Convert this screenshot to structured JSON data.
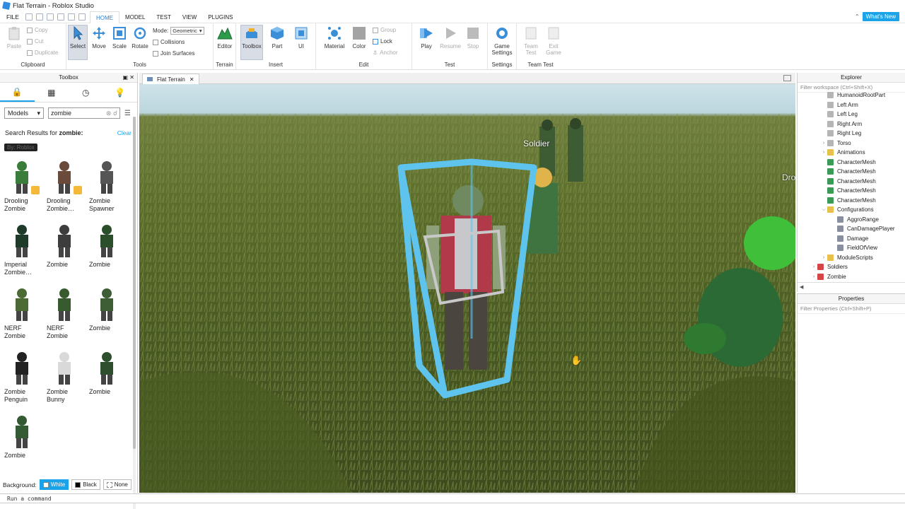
{
  "window": {
    "title": "Flat Terrain - Roblox Studio"
  },
  "menu": {
    "file": "FILE",
    "tabs": [
      "HOME",
      "MODEL",
      "TEST",
      "VIEW",
      "PLUGINS"
    ],
    "whats_new": "What's New"
  },
  "ribbon": {
    "clipboard": {
      "label": "Clipboard",
      "paste": "Paste",
      "copy": "Copy",
      "cut": "Cut",
      "duplicate": "Duplicate"
    },
    "tools": {
      "label": "Tools",
      "select": "Select",
      "move": "Move",
      "scale": "Scale",
      "rotate": "Rotate",
      "mode_label": "Mode:",
      "mode_value": "Geometric",
      "collisions": "Collisions",
      "join_surfaces": "Join Surfaces"
    },
    "terrain": {
      "label": "Terrain",
      "editor": "Editor"
    },
    "insert": {
      "label": "Insert",
      "toolbox": "Toolbox",
      "part": "Part",
      "ui": "UI"
    },
    "edit": {
      "label": "Edit",
      "material": "Material",
      "color": "Color",
      "group": "Group",
      "lock": "Lock",
      "anchor": "Anchor"
    },
    "test": {
      "label": "Test",
      "play": "Play",
      "resume": "Resume",
      "stop": "Stop"
    },
    "settings": {
      "label": "Settings",
      "game_settings_1": "Game",
      "game_settings_2": "Settings"
    },
    "teamtest": {
      "label": "Team Test",
      "team_test_1": "Team",
      "team_test_2": "Test",
      "exit_game_1": "Exit",
      "exit_game_2": "Game"
    }
  },
  "toolbox": {
    "title": "Toolbox",
    "category": "Models",
    "search_value": "zombie",
    "results_prefix": "Search Results for ",
    "results_term": "zombie:",
    "clear": "Clear",
    "filter_chip": "By: Roblox",
    "items": [
      {
        "name": "Drooling Zombie",
        "badge": true
      },
      {
        "name": "Drooling Zombie…",
        "badge": true
      },
      {
        "name": "Zombie Spawner",
        "badge": false
      },
      {
        "name": "Imperial Zombie…",
        "badge": false
      },
      {
        "name": "Zombie",
        "badge": false
      },
      {
        "name": "Zombie",
        "badge": false
      },
      {
        "name": "NERF Zombie",
        "badge": false
      },
      {
        "name": "NERF Zombie",
        "badge": false
      },
      {
        "name": "Zombie",
        "badge": false
      },
      {
        "name": "Zombie Penguin",
        "badge": false
      },
      {
        "name": "Zombie Bunny",
        "badge": false
      },
      {
        "name": "Zombie",
        "badge": false
      },
      {
        "name": "Zombie",
        "badge": false
      }
    ],
    "background_label": "Background:",
    "bg_white": "White",
    "bg_black": "Black",
    "bg_none": "None"
  },
  "document_tab": "Flat Terrain",
  "viewport": {
    "soldier_label": "Soldier",
    "drooling_label_partial": "Dro"
  },
  "explorer": {
    "title": "Explorer",
    "filter_placeholder": "Filter workspace (Ctrl+Shift+X)",
    "rows": [
      {
        "label": "HumanoidRootPart",
        "indent": 2,
        "icon": "part",
        "twisty": ""
      },
      {
        "label": "Left Arm",
        "indent": 2,
        "icon": "part",
        "twisty": ""
      },
      {
        "label": "Left Leg",
        "indent": 2,
        "icon": "part",
        "twisty": ""
      },
      {
        "label": "Right Arm",
        "indent": 2,
        "icon": "part",
        "twisty": ""
      },
      {
        "label": "Right Leg",
        "indent": 2,
        "icon": "part",
        "twisty": ""
      },
      {
        "label": "Torso",
        "indent": 2,
        "icon": "part",
        "twisty": ">"
      },
      {
        "label": "Animations",
        "indent": 2,
        "icon": "folder",
        "twisty": ">"
      },
      {
        "label": "CharacterMesh",
        "indent": 2,
        "icon": "mesh",
        "twisty": ""
      },
      {
        "label": "CharacterMesh",
        "indent": 2,
        "icon": "mesh",
        "twisty": ""
      },
      {
        "label": "CharacterMesh",
        "indent": 2,
        "icon": "mesh",
        "twisty": ""
      },
      {
        "label": "CharacterMesh",
        "indent": 2,
        "icon": "mesh",
        "twisty": ""
      },
      {
        "label": "CharacterMesh",
        "indent": 2,
        "icon": "mesh",
        "twisty": ""
      },
      {
        "label": "Configurations",
        "indent": 2,
        "icon": "folder",
        "twisty": "v"
      },
      {
        "label": "AggroRange",
        "indent": 3,
        "icon": "value",
        "twisty": ""
      },
      {
        "label": "CanDamagePlayer",
        "indent": 3,
        "icon": "value",
        "twisty": ""
      },
      {
        "label": "Damage",
        "indent": 3,
        "icon": "value",
        "twisty": ""
      },
      {
        "label": "FieldOfView",
        "indent": 3,
        "icon": "value",
        "twisty": ""
      },
      {
        "label": "ModuleScripts",
        "indent": 2,
        "icon": "folder",
        "twisty": ">"
      },
      {
        "label": "Soldiers",
        "indent": 1,
        "icon": "model",
        "twisty": ">"
      },
      {
        "label": "Zombie",
        "indent": 1,
        "icon": "model",
        "twisty": ">"
      }
    ]
  },
  "properties": {
    "title": "Properties",
    "filter_placeholder": "Filter Properties (Ctrl+Shift+P)"
  },
  "command_bar": {
    "placeholder": "Run a command"
  },
  "colors": {
    "accent": "#1aa3e8",
    "selection_box": "#5ec4ee"
  }
}
